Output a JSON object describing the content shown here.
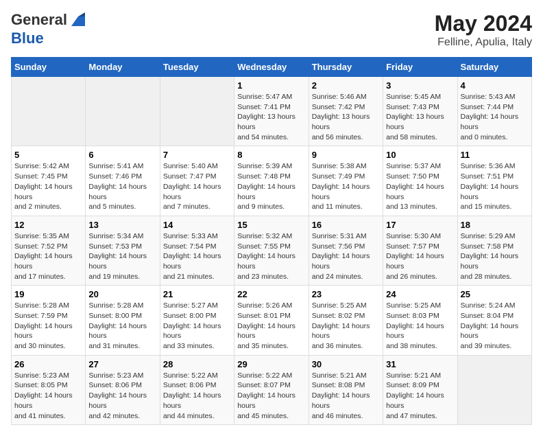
{
  "header": {
    "logo_line1": "General",
    "logo_line2": "Blue",
    "main_title": "May 2024",
    "subtitle": "Felline, Apulia, Italy"
  },
  "weekdays": [
    "Sunday",
    "Monday",
    "Tuesday",
    "Wednesday",
    "Thursday",
    "Friday",
    "Saturday"
  ],
  "weeks": [
    [
      {
        "day": "",
        "info": ""
      },
      {
        "day": "",
        "info": ""
      },
      {
        "day": "",
        "info": ""
      },
      {
        "day": "1",
        "info": "Sunrise: 5:47 AM\nSunset: 7:41 PM\nDaylight: 13 hours and 54 minutes."
      },
      {
        "day": "2",
        "info": "Sunrise: 5:46 AM\nSunset: 7:42 PM\nDaylight: 13 hours and 56 minutes."
      },
      {
        "day": "3",
        "info": "Sunrise: 5:45 AM\nSunset: 7:43 PM\nDaylight: 13 hours and 58 minutes."
      },
      {
        "day": "4",
        "info": "Sunrise: 5:43 AM\nSunset: 7:44 PM\nDaylight: 14 hours and 0 minutes."
      }
    ],
    [
      {
        "day": "5",
        "info": "Sunrise: 5:42 AM\nSunset: 7:45 PM\nDaylight: 14 hours and 2 minutes."
      },
      {
        "day": "6",
        "info": "Sunrise: 5:41 AM\nSunset: 7:46 PM\nDaylight: 14 hours and 5 minutes."
      },
      {
        "day": "7",
        "info": "Sunrise: 5:40 AM\nSunset: 7:47 PM\nDaylight: 14 hours and 7 minutes."
      },
      {
        "day": "8",
        "info": "Sunrise: 5:39 AM\nSunset: 7:48 PM\nDaylight: 14 hours and 9 minutes."
      },
      {
        "day": "9",
        "info": "Sunrise: 5:38 AM\nSunset: 7:49 PM\nDaylight: 14 hours and 11 minutes."
      },
      {
        "day": "10",
        "info": "Sunrise: 5:37 AM\nSunset: 7:50 PM\nDaylight: 14 hours and 13 minutes."
      },
      {
        "day": "11",
        "info": "Sunrise: 5:36 AM\nSunset: 7:51 PM\nDaylight: 14 hours and 15 minutes."
      }
    ],
    [
      {
        "day": "12",
        "info": "Sunrise: 5:35 AM\nSunset: 7:52 PM\nDaylight: 14 hours and 17 minutes."
      },
      {
        "day": "13",
        "info": "Sunrise: 5:34 AM\nSunset: 7:53 PM\nDaylight: 14 hours and 19 minutes."
      },
      {
        "day": "14",
        "info": "Sunrise: 5:33 AM\nSunset: 7:54 PM\nDaylight: 14 hours and 21 minutes."
      },
      {
        "day": "15",
        "info": "Sunrise: 5:32 AM\nSunset: 7:55 PM\nDaylight: 14 hours and 23 minutes."
      },
      {
        "day": "16",
        "info": "Sunrise: 5:31 AM\nSunset: 7:56 PM\nDaylight: 14 hours and 24 minutes."
      },
      {
        "day": "17",
        "info": "Sunrise: 5:30 AM\nSunset: 7:57 PM\nDaylight: 14 hours and 26 minutes."
      },
      {
        "day": "18",
        "info": "Sunrise: 5:29 AM\nSunset: 7:58 PM\nDaylight: 14 hours and 28 minutes."
      }
    ],
    [
      {
        "day": "19",
        "info": "Sunrise: 5:28 AM\nSunset: 7:59 PM\nDaylight: 14 hours and 30 minutes."
      },
      {
        "day": "20",
        "info": "Sunrise: 5:28 AM\nSunset: 8:00 PM\nDaylight: 14 hours and 31 minutes."
      },
      {
        "day": "21",
        "info": "Sunrise: 5:27 AM\nSunset: 8:00 PM\nDaylight: 14 hours and 33 minutes."
      },
      {
        "day": "22",
        "info": "Sunrise: 5:26 AM\nSunset: 8:01 PM\nDaylight: 14 hours and 35 minutes."
      },
      {
        "day": "23",
        "info": "Sunrise: 5:25 AM\nSunset: 8:02 PM\nDaylight: 14 hours and 36 minutes."
      },
      {
        "day": "24",
        "info": "Sunrise: 5:25 AM\nSunset: 8:03 PM\nDaylight: 14 hours and 38 minutes."
      },
      {
        "day": "25",
        "info": "Sunrise: 5:24 AM\nSunset: 8:04 PM\nDaylight: 14 hours and 39 minutes."
      }
    ],
    [
      {
        "day": "26",
        "info": "Sunrise: 5:23 AM\nSunset: 8:05 PM\nDaylight: 14 hours and 41 minutes."
      },
      {
        "day": "27",
        "info": "Sunrise: 5:23 AM\nSunset: 8:06 PM\nDaylight: 14 hours and 42 minutes."
      },
      {
        "day": "28",
        "info": "Sunrise: 5:22 AM\nSunset: 8:06 PM\nDaylight: 14 hours and 44 minutes."
      },
      {
        "day": "29",
        "info": "Sunrise: 5:22 AM\nSunset: 8:07 PM\nDaylight: 14 hours and 45 minutes."
      },
      {
        "day": "30",
        "info": "Sunrise: 5:21 AM\nSunset: 8:08 PM\nDaylight: 14 hours and 46 minutes."
      },
      {
        "day": "31",
        "info": "Sunrise: 5:21 AM\nSunset: 8:09 PM\nDaylight: 14 hours and 47 minutes."
      },
      {
        "day": "",
        "info": ""
      }
    ]
  ]
}
